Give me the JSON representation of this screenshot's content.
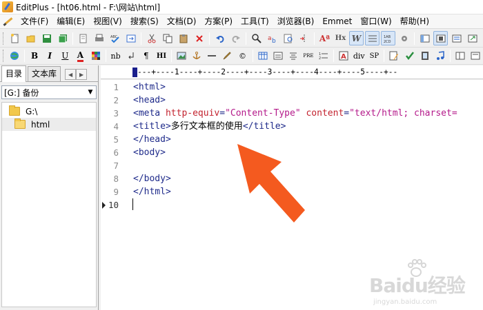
{
  "window": {
    "title": "EditPlus - [ht06.html - F:\\网站\\html]"
  },
  "menu": {
    "items": [
      "文件(F)",
      "编辑(E)",
      "视图(V)",
      "搜索(S)",
      "文档(D)",
      "方案(P)",
      "工具(T)",
      "浏览器(B)",
      "Emmet",
      "窗口(W)",
      "帮助(H)"
    ]
  },
  "toolbar2": {
    "labels": [
      "B",
      "I",
      "U",
      "A",
      "nb",
      "¶",
      "HI",
      "PRE",
      "div",
      "SP"
    ]
  },
  "sidebar": {
    "tabs": [
      "目录",
      "文本库"
    ],
    "drive": "[G:] 备份",
    "tree": [
      "G:\\",
      "html"
    ]
  },
  "ruler": {
    "text": "---+----1----+----2----+----3----+----4----+----5----+--"
  },
  "editor": {
    "line_numbers": [
      "1",
      "2",
      "3",
      "4",
      "5",
      "6",
      "7",
      "8",
      "9",
      "10"
    ],
    "lines": [
      {
        "tag1": "<html>"
      },
      {
        "tag1": "<head>"
      },
      {
        "tag1": "<meta ",
        "attr1": "http-equiv",
        "eq1": "=",
        "val1": "\"Content-Type\"",
        "attr2": " content",
        "eq2": "=",
        "val2": "\"text/html; charset="
      },
      {
        "tag1": "<title>",
        "text": "多行文本框的使用",
        "tag2": "</title>"
      },
      {
        "tag1": "</head>"
      },
      {
        "tag1": "<body>"
      },
      {
        "tag1": ""
      },
      {
        "tag1": "</body>"
      },
      {
        "tag1": "</html>"
      },
      {
        "tag1": ""
      }
    ]
  },
  "colors": {
    "tag": "#1e2a8a",
    "attribute": "#c3222e",
    "value": "#b4198a",
    "arrow": "#f45a1f"
  },
  "watermark": {
    "logo": "Baidu经验",
    "sub": "jingyan.baidu.com"
  }
}
